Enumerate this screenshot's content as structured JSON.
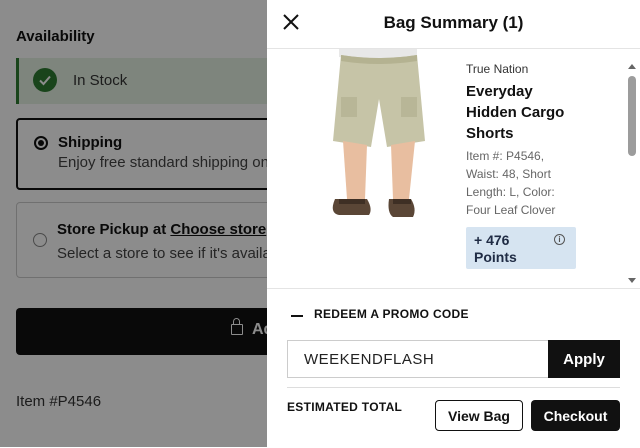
{
  "background": {
    "availability_title": "Availability",
    "in_stock": "In Stock",
    "shipping_title": "Shipping",
    "shipping_subtitle": "Enjoy free standard shipping on",
    "pickup_title": "Store Pickup at ",
    "pickup_link": "Choose store",
    "pickup_subtitle": "Select a store to see if it's availa",
    "add_button_label": "Ad",
    "item_number": "Item #P4546"
  },
  "drawer": {
    "title": "Bag Summary (1)",
    "product": {
      "brand": "True Nation",
      "name": "Everyday Hidden Cargo Shorts",
      "details": "Item #: P4546, Waist: 48, Short Length: L, Color: Four Leaf Clover",
      "points": "+ 476 Points",
      "info_icon": "i"
    },
    "promo": {
      "toggle_label": "REDEEM A PROMO CODE",
      "input_value": "WEEKENDFLASH",
      "apply_label": "Apply"
    },
    "estimated_total_label": "ESTIMATED TOTAL",
    "view_bag_label": "View Bag",
    "checkout_label": "Checkout"
  },
  "colors": {
    "stock_green": "#2e7d32",
    "stock_bg": "#e6f2e4",
    "points_bg": "#d6e4f1",
    "primary_dark": "#111111"
  },
  "icons": {
    "close": "close-icon",
    "check": "checkmark-icon",
    "lock": "lock-icon",
    "minus": "minus-icon",
    "info": "info-icon"
  }
}
